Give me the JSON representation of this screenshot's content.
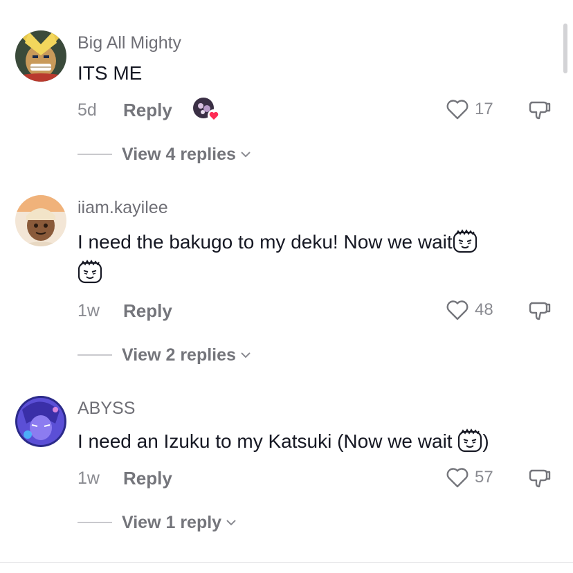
{
  "comments": [
    {
      "username": "Big All Mighty",
      "text_parts": [
        "ITS ME"
      ],
      "time": "5d",
      "reply_label": "Reply",
      "like_count": "17",
      "view_replies": "View 4 replies",
      "avatar_icon": "all-might-avatar",
      "liked_by_creator": true
    },
    {
      "username": "iiam.kayilee",
      "text_parts": [
        "I need the bakugo to my deku! Now we wait"
      ],
      "time": "1w",
      "reply_label": "Reply",
      "like_count": "48",
      "view_replies": "View 2 replies",
      "avatar_icon": "anime-character-avatar",
      "emojis": [
        "smirk-sticker-emoji",
        "smirk-sticker-emoji"
      ]
    },
    {
      "username": "ABYSS",
      "text_parts": [
        "I need an Izuku to my Katsuki (Now we wait ",
        ")"
      ],
      "time": "1w",
      "reply_label": "Reply",
      "like_count": "57",
      "view_replies": "View 1 reply",
      "avatar_icon": "purple-anime-avatar",
      "emojis": [
        "smirk-sticker-emoji"
      ]
    }
  ],
  "colors": {
    "text_primary": "#161823",
    "text_secondary": "#8a8b91",
    "heart_red": "#fe2c55"
  }
}
